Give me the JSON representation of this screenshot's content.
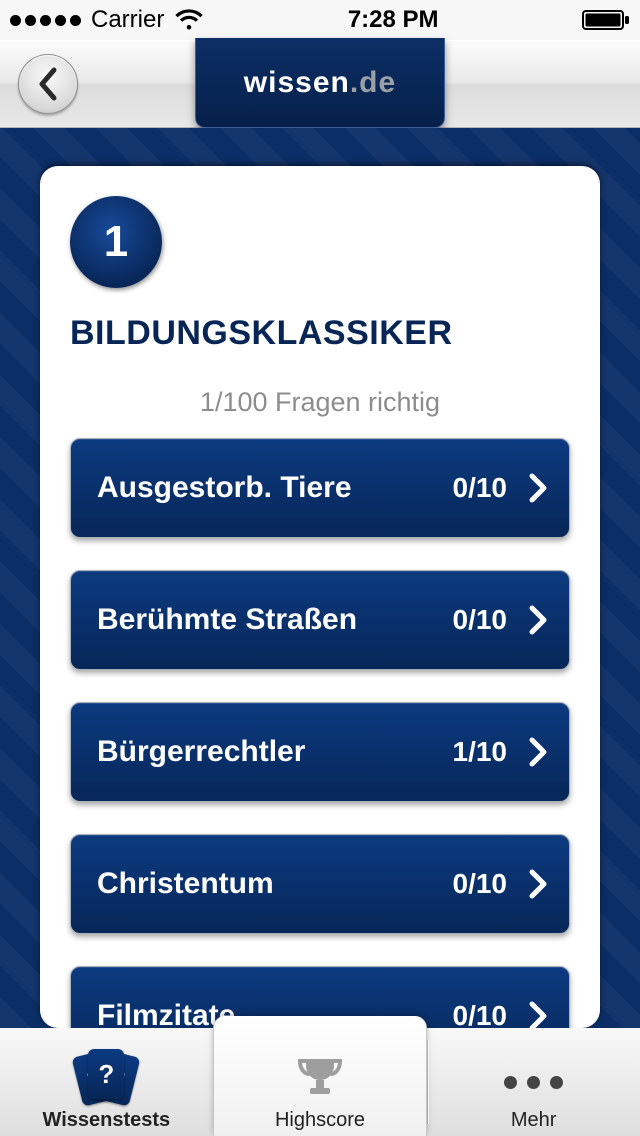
{
  "status": {
    "carrier": "Carrier",
    "time": "7:28 PM"
  },
  "header": {
    "logo_wissen": "wissen",
    "logo_de": ".de"
  },
  "card": {
    "score_total": "1",
    "title": "BILDUNGSKLASSIKER",
    "subtitle": "1/100 Fragen richtig"
  },
  "topics": [
    {
      "label": "Ausgestorb. Tiere",
      "score": "0/10"
    },
    {
      "label": "Berühmte Straßen",
      "score": "0/10"
    },
    {
      "label": "Bürgerrechtler",
      "score": "1/10"
    },
    {
      "label": "Christentum",
      "score": "0/10"
    },
    {
      "label": "Filmzitate",
      "score": "0/10"
    }
  ],
  "tabs": {
    "wissenstests": "Wissenstests",
    "highscore": "Highscore",
    "mehr": "Mehr"
  },
  "colors": {
    "brand_blue": "#072758",
    "brand_blue_light": "#0c3a80"
  }
}
